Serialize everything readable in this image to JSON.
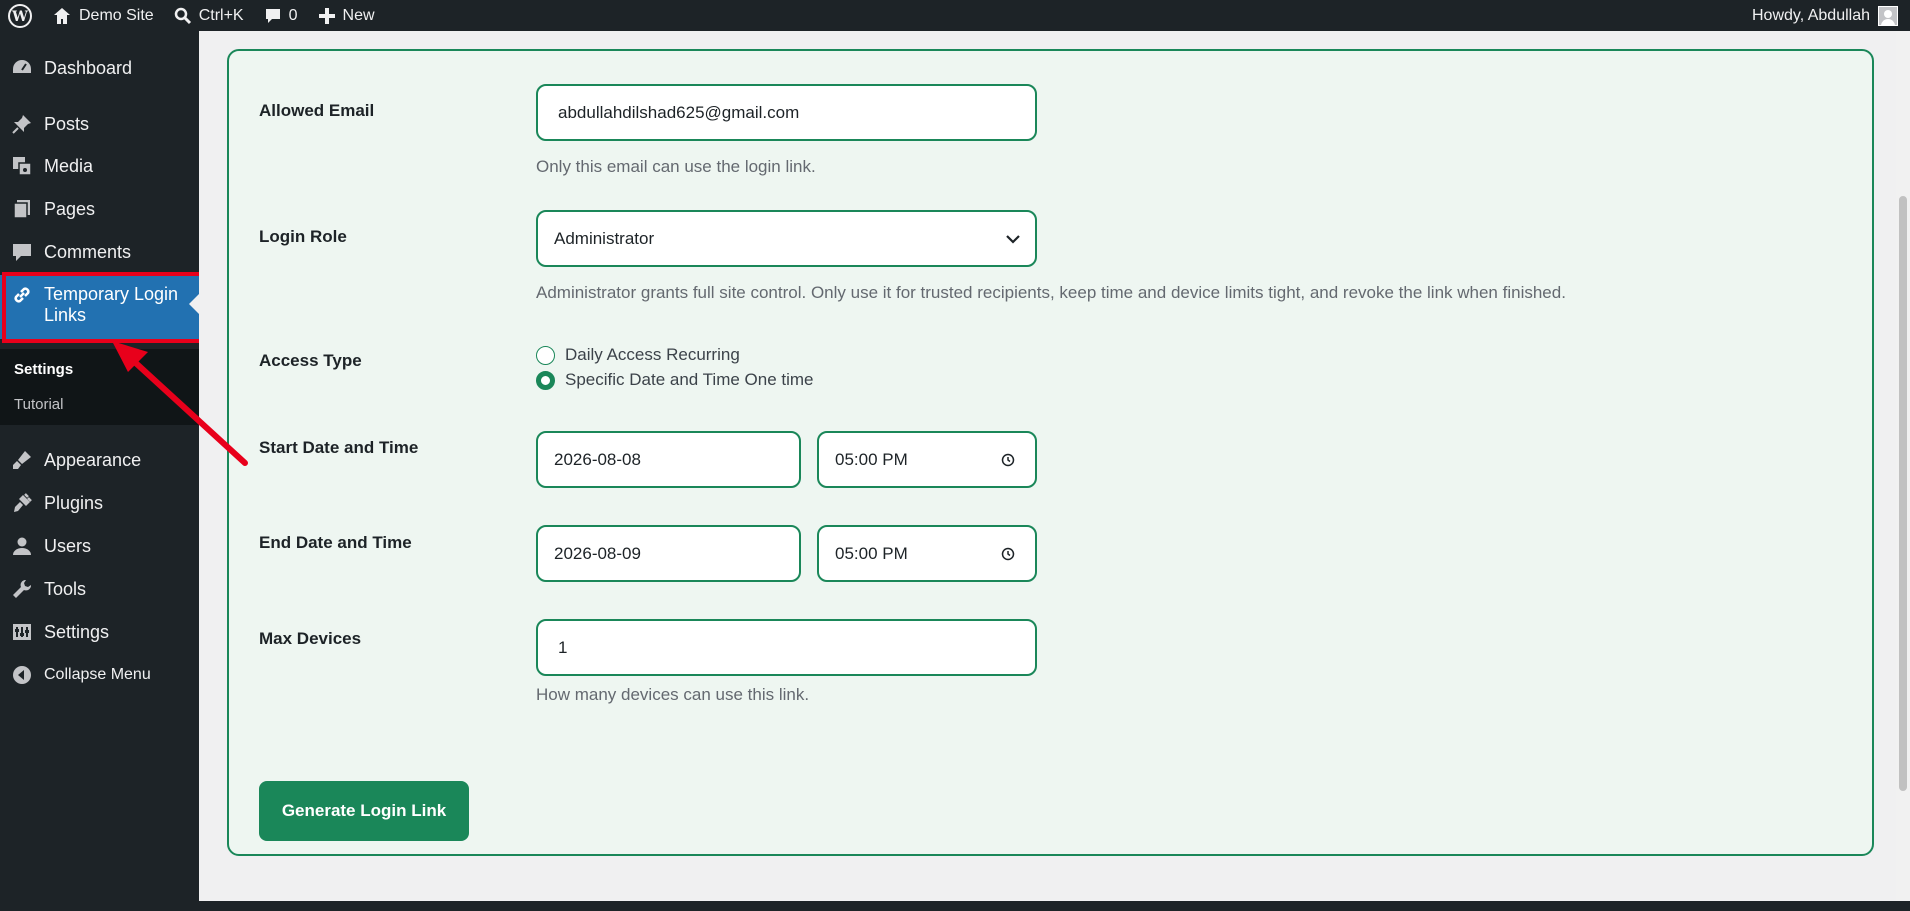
{
  "adminbar": {
    "site_name": "Demo Site",
    "search_shortcut": "Ctrl+K",
    "comments_count": "0",
    "new_label": "New",
    "howdy": "Howdy, Abdullah"
  },
  "sidebar": {
    "items": [
      {
        "label": "Dashboard",
        "icon": "dashboard-icon"
      },
      {
        "label": "Posts",
        "icon": "pin-icon"
      },
      {
        "label": "Media",
        "icon": "media-icon"
      },
      {
        "label": "Pages",
        "icon": "pages-icon"
      },
      {
        "label": "Comments",
        "icon": "comment-icon"
      },
      {
        "label": "Temporary Login Links",
        "icon": "link-icon",
        "active": true
      },
      {
        "label": "Appearance",
        "icon": "brush-icon"
      },
      {
        "label": "Plugins",
        "icon": "plugin-icon"
      },
      {
        "label": "Users",
        "icon": "user-icon"
      },
      {
        "label": "Tools",
        "icon": "wrench-icon"
      },
      {
        "label": "Settings",
        "icon": "settings-icon"
      },
      {
        "label": "Collapse Menu",
        "icon": "collapse-icon"
      }
    ],
    "submenu": [
      {
        "label": "Settings",
        "current": true
      },
      {
        "label": "Tutorial",
        "current": false
      }
    ]
  },
  "form": {
    "allowed_email": {
      "label": "Allowed Email",
      "value": "abdullahdilshad625@gmail.com",
      "help": "Only this email can use the login link."
    },
    "login_role": {
      "label": "Login Role",
      "value": "Administrator",
      "help": "Administrator grants full site control. Only use it for trusted recipients, keep time and device limits tight, and revoke the link when finished."
    },
    "access_type": {
      "label": "Access Type",
      "options": [
        {
          "label": "Daily Access Recurring",
          "checked": false
        },
        {
          "label": "Specific Date and Time One time",
          "checked": true
        }
      ]
    },
    "start": {
      "label": "Start Date and Time",
      "date": "2026-08-08",
      "time": "05:00 PM"
    },
    "end": {
      "label": "End Date and Time",
      "date": "2026-08-09",
      "time": "05:00 PM"
    },
    "max_devices": {
      "label": "Max Devices",
      "value": "1",
      "help": "How many devices can use this link."
    },
    "submit_label": "Generate Login Link"
  },
  "colors": {
    "accent": "#1a8759",
    "sidebar_bg": "#1d2327",
    "active_menu": "#2271b1",
    "highlight": "#e8001b"
  }
}
